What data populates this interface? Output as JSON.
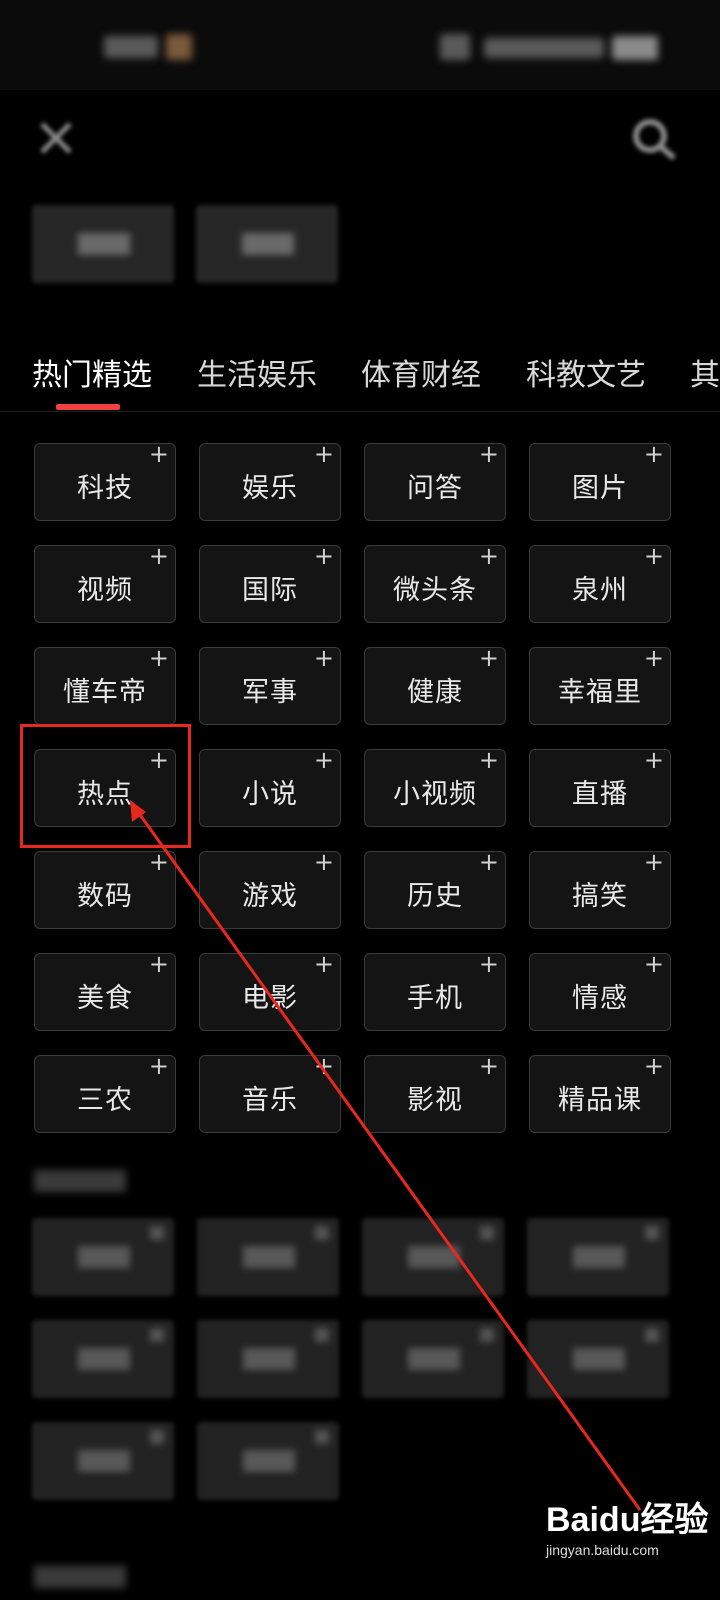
{
  "category_tabs": [
    {
      "label": "热门精选",
      "active": true
    },
    {
      "label": "生活娱乐",
      "active": false
    },
    {
      "label": "体育财经",
      "active": false
    },
    {
      "label": "科教文艺",
      "active": false
    },
    {
      "label": "其",
      "active": false
    }
  ],
  "channels": [
    {
      "label": "科技"
    },
    {
      "label": "娱乐"
    },
    {
      "label": "问答"
    },
    {
      "label": "图片"
    },
    {
      "label": "视频"
    },
    {
      "label": "国际"
    },
    {
      "label": "微头条"
    },
    {
      "label": "泉州"
    },
    {
      "label": "懂车帝"
    },
    {
      "label": "军事"
    },
    {
      "label": "健康"
    },
    {
      "label": "幸福里"
    },
    {
      "label": "热点"
    },
    {
      "label": "小说"
    },
    {
      "label": "小视频"
    },
    {
      "label": "直播"
    },
    {
      "label": "数码"
    },
    {
      "label": "游戏"
    },
    {
      "label": "历史"
    },
    {
      "label": "搞笑"
    },
    {
      "label": "美食"
    },
    {
      "label": "电影"
    },
    {
      "label": "手机"
    },
    {
      "label": "情感"
    },
    {
      "label": "三农"
    },
    {
      "label": "音乐"
    },
    {
      "label": "影视"
    },
    {
      "label": "精品课"
    }
  ],
  "plus_symbol": "+",
  "annotation": {
    "highlighted_channel": "热点",
    "color": "#e8271f"
  },
  "watermark": {
    "logo_left": "Bai",
    "logo_mid": "du",
    "logo_right": "经验",
    "sub": "jingyan.baidu.com"
  },
  "colors": {
    "accent": "#f04142",
    "background": "#000000",
    "button_bg": "#141414",
    "button_border": "#3a3a3a"
  },
  "icons": {
    "close": "close-icon",
    "search": "search-icon",
    "add": "plus-icon"
  }
}
